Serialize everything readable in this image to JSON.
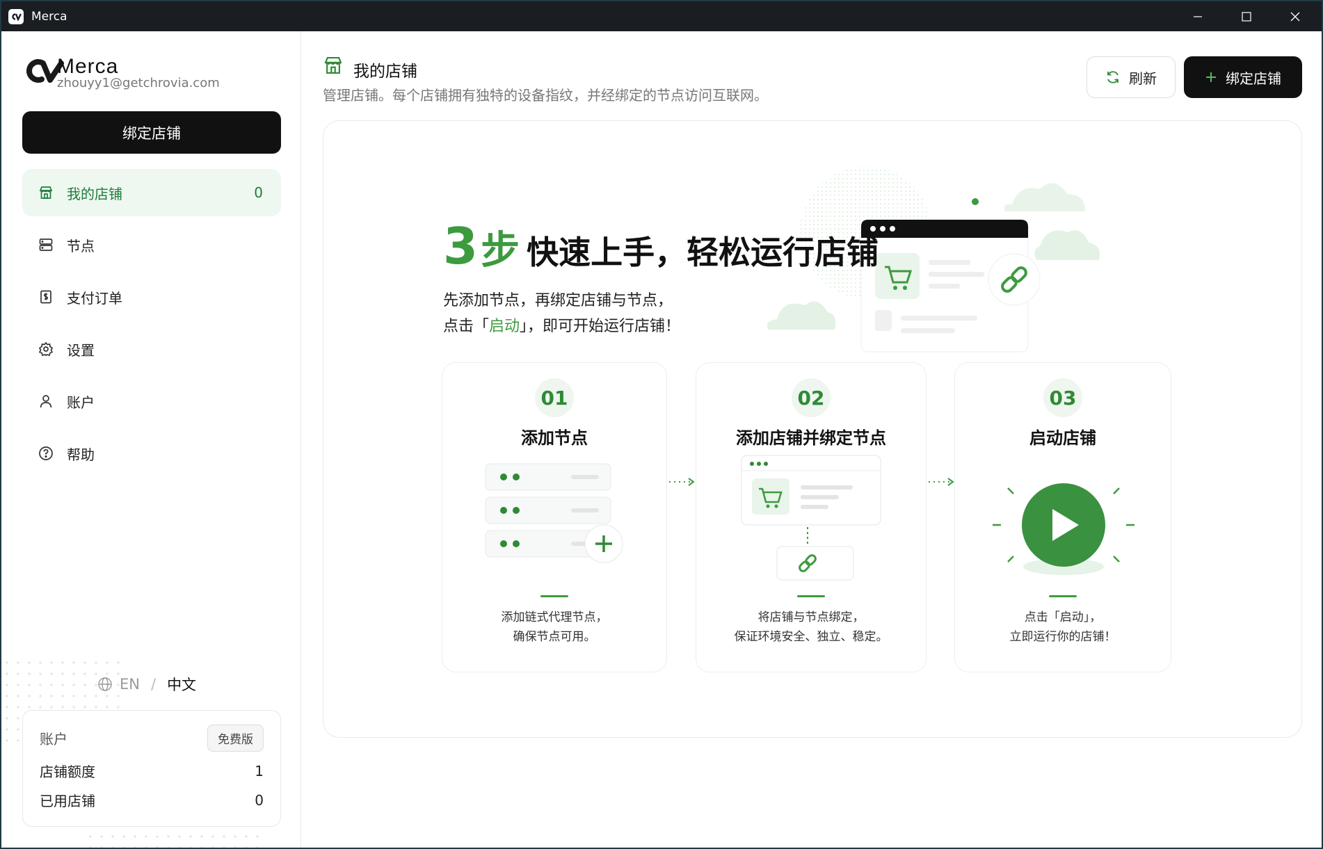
{
  "window": {
    "title": "Merca"
  },
  "sidebar": {
    "brand_name": "Merca",
    "email": "zhouyy1@getchrovia.com",
    "bind_button": "绑定店铺",
    "items": [
      {
        "label": "我的店铺",
        "icon": "store-icon",
        "count": "0"
      },
      {
        "label": "节点",
        "icon": "server-icon"
      },
      {
        "label": "支付订单",
        "icon": "receipt-icon"
      },
      {
        "label": "设置",
        "icon": "gear-icon"
      },
      {
        "label": "账户",
        "icon": "user-icon"
      },
      {
        "label": "帮助",
        "icon": "help-icon"
      }
    ],
    "lang": {
      "en": "EN",
      "sep": "/",
      "zh": "中文"
    },
    "account_card": {
      "label": "账户",
      "plan": "免费版",
      "quota_label": "店铺额度",
      "quota_value": "1",
      "used_label": "已用店铺",
      "used_value": "0"
    }
  },
  "header": {
    "title": "我的店铺",
    "subtitle": "管理店铺。每个店铺拥有独特的设备指纹，并经绑定的节点访问互联网。",
    "refresh_label": "刷新",
    "bind_label": "绑定店铺"
  },
  "hero": {
    "num": "3",
    "step_char": "步",
    "rest": "快速上手，轻松运行店铺",
    "line1": "先添加节点，再绑定店铺与节点，",
    "line2_a": "点击「",
    "line2_hl": "启动",
    "line2_b": "」，即可开始运行店铺！"
  },
  "steps": [
    {
      "num": "01",
      "name": "添加节点",
      "desc1": "添加链式代理节点，",
      "desc2": "确保节点可用。"
    },
    {
      "num": "02",
      "name": "添加店铺并绑定节点",
      "desc1": "将店铺与节点绑定，",
      "desc2": "保证环境安全、独立、稳定。"
    },
    {
      "num": "03",
      "name": "启动店铺",
      "desc1": "点击「启动」，",
      "desc2": "立即运行你的店铺！"
    }
  ],
  "colors": {
    "accent": "#3d9a3f",
    "active_bg": "#eef7f0",
    "dark": "#111111",
    "titlebar": "#1a1d21"
  }
}
